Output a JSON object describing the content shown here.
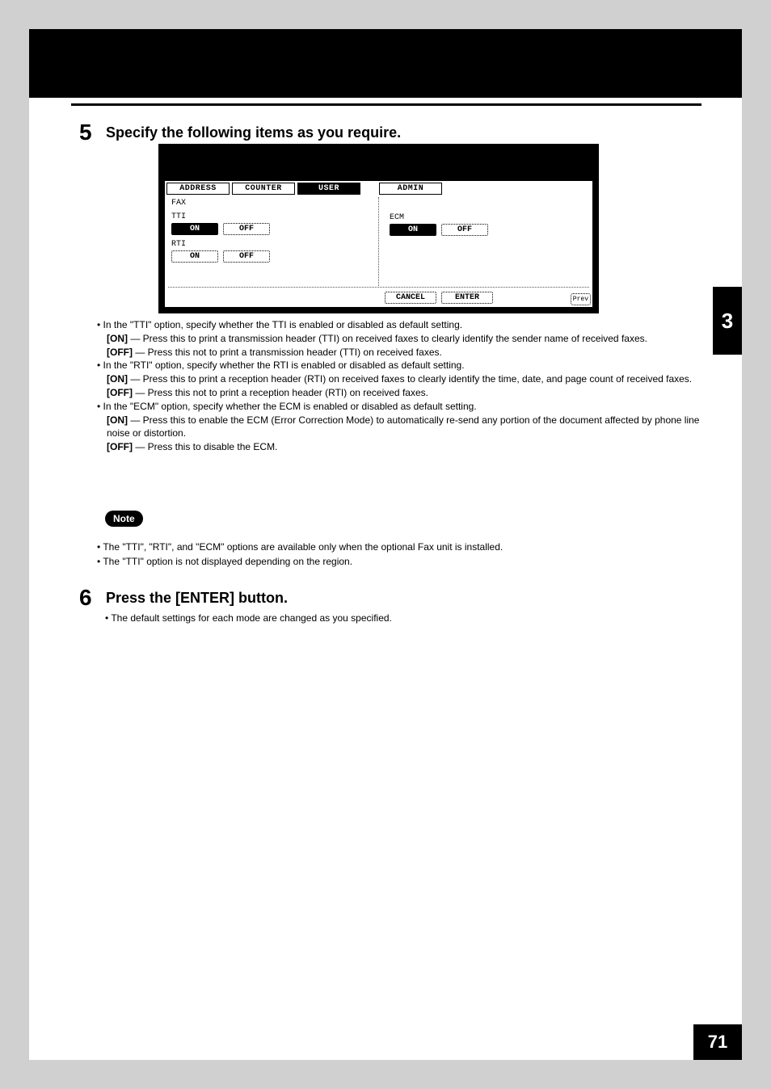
{
  "chapter_number": "3",
  "page_number": "71",
  "step5": {
    "number": "5",
    "title": "Specify the following items as you require."
  },
  "screen": {
    "tabs": {
      "address": "ADDRESS",
      "counter": "COUNTER",
      "user": "USER",
      "admin": "ADMIN"
    },
    "labels": {
      "fax": "FAX",
      "tti": "TTI",
      "rti": "RTI",
      "ecm": "ECM"
    },
    "buttons": {
      "on": "ON",
      "off": "OFF",
      "cancel": "CANCEL",
      "enter": "ENTER",
      "prev": "Prev"
    }
  },
  "explain": {
    "tti_intro": "In the \"TTI\" option, specify whether the TTI is enabled or disabled as default setting.",
    "tti_on": " — Press this to print a transmission header (TTI) on received faxes to clearly identify the sender name of received faxes.",
    "tti_off": " — Press this not to print a transmission header (TTI) on received faxes.",
    "rti_intro": "In the \"RTI\" option, specify whether the RTI is enabled or disabled as default setting.",
    "rti_on": " — Press this to print a reception header (RTI) on received faxes to clearly identify the time, date, and page count of received faxes.",
    "rti_off": " — Press this not to print a reception header (RTI) on received faxes.",
    "ecm_intro": "In the \"ECM\" option, specify whether the ECM is enabled or disabled as default setting.",
    "ecm_on": " — Press this to enable the ECM (Error Correction Mode) to automatically re-send any portion of the document affected by phone line noise or distortion.",
    "ecm_off": " — Press this to disable the ECM.",
    "on_label": "[ON]",
    "off_label": "[OFF]"
  },
  "note": {
    "label": "Note",
    "line1": "The \"TTI\", \"RTI\", and \"ECM\" options are available only when the optional Fax unit is installed.",
    "line2": "The \"TTI\" option is not displayed depending on the region."
  },
  "step6": {
    "number": "6",
    "title": "Press the [ENTER] button.",
    "bullet": "The default settings for each mode are changed as you specified."
  }
}
